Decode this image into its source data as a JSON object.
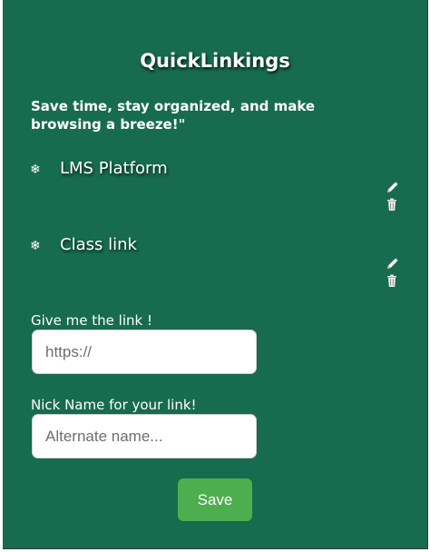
{
  "app": {
    "title": "QuickLinkings",
    "tagline": "Save time, stay organized, and make browsing a breeze!\""
  },
  "links": [
    {
      "bullet": "❄",
      "name": "LMS Platform"
    },
    {
      "bullet": "❄",
      "name": "Class link"
    }
  ],
  "form": {
    "link_label": "Give me the link !",
    "link_placeholder": "https://",
    "nickname_label": "Nick Name for your link!",
    "nickname_placeholder": "Alternate name...",
    "save_label": "Save"
  },
  "icons": {
    "bullet": "snowflake-icon",
    "edit": "pencil-icon",
    "delete": "trash-icon"
  },
  "colors": {
    "background": "#176b4e",
    "save_button": "#4cae4f",
    "text": "#ffffff"
  }
}
